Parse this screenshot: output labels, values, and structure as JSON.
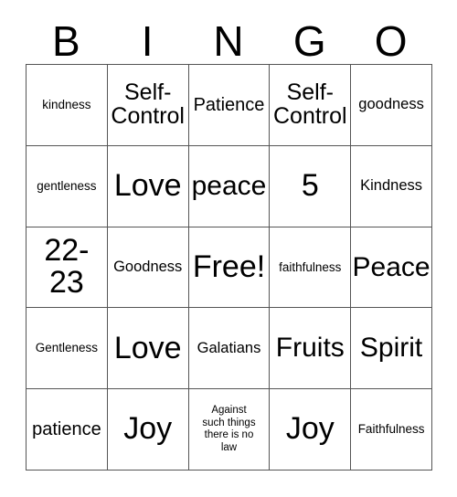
{
  "card": {
    "headers": [
      "B",
      "I",
      "N",
      "G",
      "O"
    ],
    "rows": [
      [
        {
          "text": "kindness",
          "size": "sm"
        },
        {
          "text": "Self-\nControl",
          "size": "xl"
        },
        {
          "text": "Patience",
          "size": "lg"
        },
        {
          "text": "Self-\nControl",
          "size": "xl"
        },
        {
          "text": "goodness",
          "size": "md"
        }
      ],
      [
        {
          "text": "gentleness",
          "size": "sm"
        },
        {
          "text": "Love",
          "size": "hg"
        },
        {
          "text": "peace",
          "size": "xxl"
        },
        {
          "text": "5",
          "size": "hg"
        },
        {
          "text": "Kindness",
          "size": "md"
        }
      ],
      [
        {
          "text": "22-\n23",
          "size": "hg"
        },
        {
          "text": "Goodness",
          "size": "md"
        },
        {
          "text": "Free!",
          "size": "hg"
        },
        {
          "text": "faithfulness",
          "size": "sm"
        },
        {
          "text": "Peace",
          "size": "xxl"
        }
      ],
      [
        {
          "text": "Gentleness",
          "size": "sm"
        },
        {
          "text": "Love",
          "size": "hg"
        },
        {
          "text": "Galatians",
          "size": "md"
        },
        {
          "text": "Fruits",
          "size": "xxl"
        },
        {
          "text": "Spirit",
          "size": "xxl"
        }
      ],
      [
        {
          "text": "patience",
          "size": "lg"
        },
        {
          "text": "Joy",
          "size": "hg"
        },
        {
          "text": "Against\nsuch things\nthere is no\nlaw",
          "size": "xs"
        },
        {
          "text": "Joy",
          "size": "hg"
        },
        {
          "text": "Faithfulness",
          "size": "sm"
        }
      ]
    ],
    "colors": {
      "border": "#555555",
      "text": "#000000",
      "background": "#ffffff"
    }
  }
}
